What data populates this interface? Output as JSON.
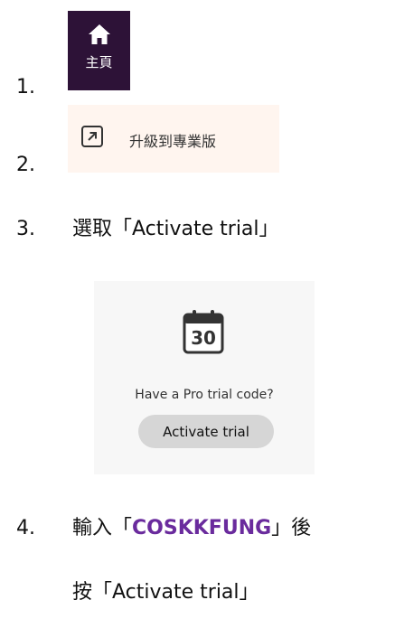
{
  "steps": [
    {
      "number": "1."
    },
    {
      "number": "2."
    },
    {
      "number": "3.",
      "text": "選取「Activate trial」"
    },
    {
      "number": "4.",
      "text_before": "輸入「",
      "code": "COSKKFUNG",
      "text_after": "」後",
      "line2": "按「Activate trial」"
    }
  ],
  "home_tile": {
    "label": "主頁",
    "icon": "home-icon",
    "bg_color": "#2d1237"
  },
  "upgrade_row": {
    "label": "升級到專業版",
    "icon": "external-arrow-icon",
    "bg_color": "#fff5ef"
  },
  "trial_card": {
    "calendar_number": "30",
    "question": "Have a Pro trial code?",
    "button_label": "Activate trial"
  },
  "accent_color": "#6a2b9d"
}
